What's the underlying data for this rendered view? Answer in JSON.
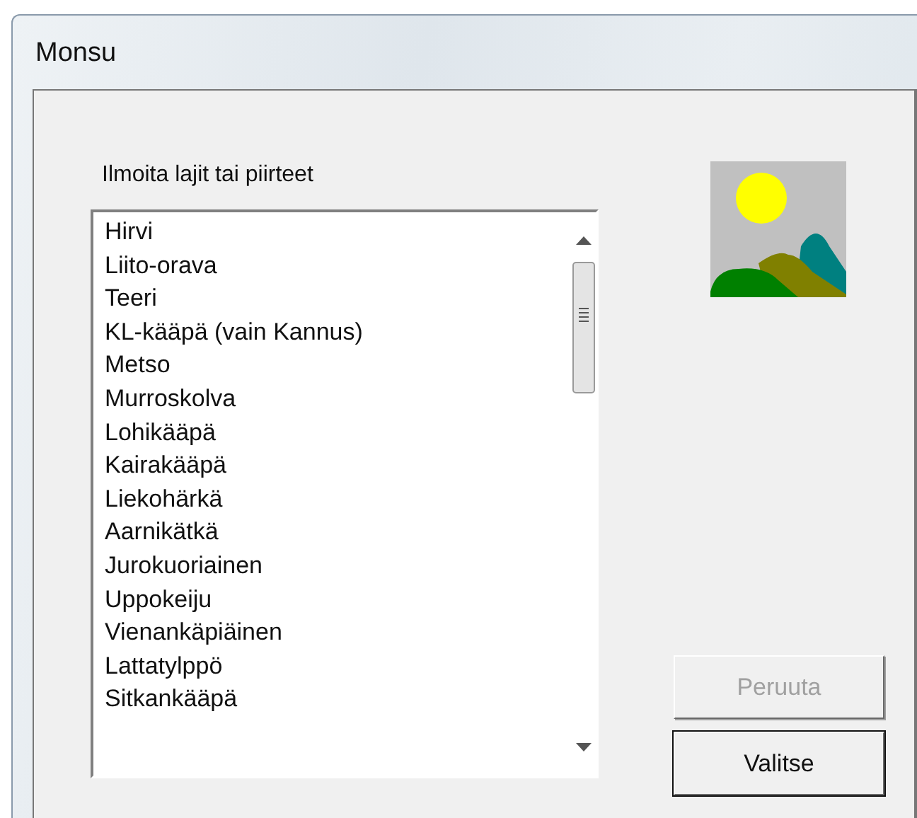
{
  "window": {
    "title": "Monsu"
  },
  "list_label": "Ilmoita lajit tai piirteet",
  "list_items": [
    {
      "text": "Hirvi",
      "selected": false
    },
    {
      "text": "Liito-orava",
      "selected": false
    },
    {
      "text": "Teeri",
      "selected": false
    },
    {
      "text": "KL-kääpä (vain Kannus)",
      "selected": false
    },
    {
      "text": "Metso",
      "selected": false
    },
    {
      "text": "Murroskolva",
      "selected": false
    },
    {
      "text": "Lohikääpä",
      "selected": false
    },
    {
      "text": "Kairakääpä",
      "selected": false
    },
    {
      "text": "Liekohärkä",
      "selected": false
    },
    {
      "text": "Aarnikätkä",
      "selected": false
    },
    {
      "text": "Jurokuoriainen",
      "selected": false
    },
    {
      "text": "Uppokeiju",
      "selected": false
    },
    {
      "text": "Vienankäpiäinen",
      "selected": false
    },
    {
      "text": "Lattatylppö",
      "selected": false
    },
    {
      "text": "Sitkankääpä",
      "selected": false
    }
  ],
  "buttons": [
    {
      "label": "Peruuta",
      "disabled": true
    },
    {
      "label": "Valitse",
      "disabled": false
    }
  ]
}
